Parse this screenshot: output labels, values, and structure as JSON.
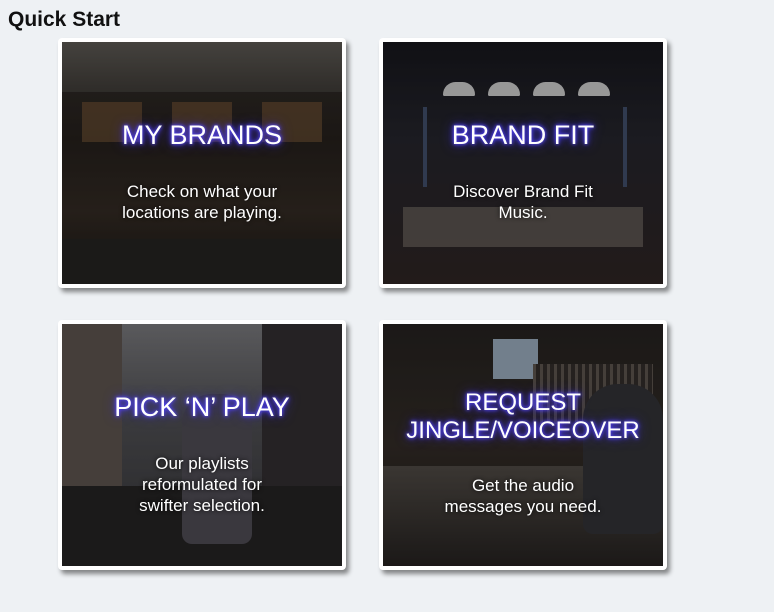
{
  "page": {
    "title": "Quick Start"
  },
  "cards": [
    {
      "title": "MY BRANDS",
      "description": "Check on what your locations are playing."
    },
    {
      "title": "BRAND FIT",
      "description": "Discover Brand Fit Music."
    },
    {
      "title": "PICK ‘N’ PLAY",
      "description": "Our playlists reformulated for swifter selection."
    },
    {
      "title": "REQUEST\nJINGLE/VOICEOVER",
      "description": "Get the audio messages you need."
    }
  ],
  "colors": {
    "background": "#eef1f4",
    "title_glow": "#4a3cff",
    "card_border": "#ffffff"
  }
}
